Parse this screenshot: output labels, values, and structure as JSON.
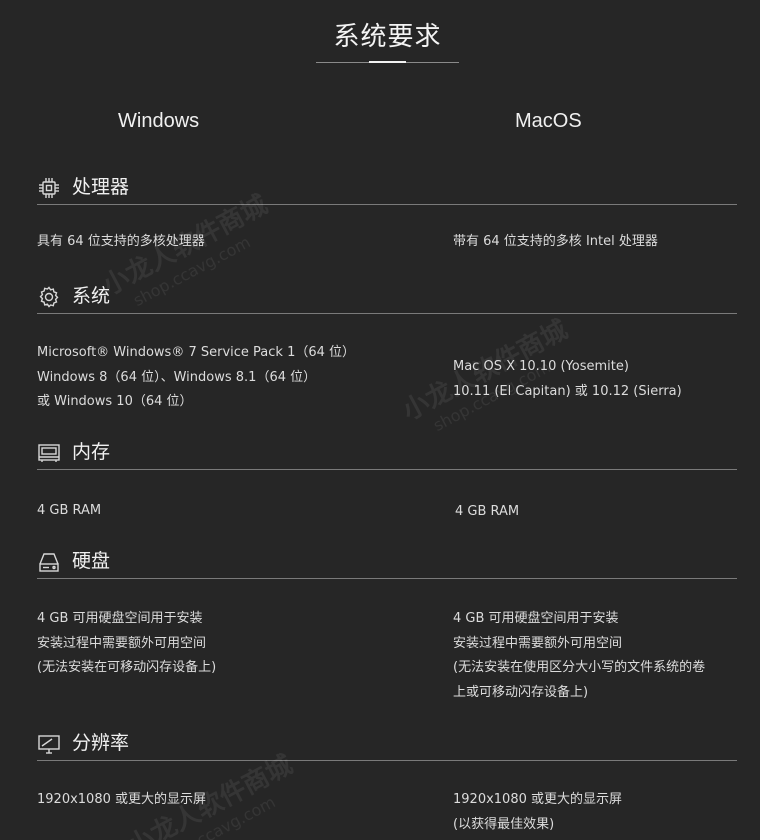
{
  "page": {
    "title": "系统要求"
  },
  "columns": {
    "windows": "Windows",
    "macos": "MacOS"
  },
  "sections": {
    "processor": {
      "label": "处理器",
      "icon": "cpu-icon",
      "windows": [
        "具有 64 位支持的多核处理器"
      ],
      "macos": [
        "带有 64 位支持的多核 Intel 处理器"
      ]
    },
    "system": {
      "label": "系统",
      "icon": "gear-icon",
      "windows": [
        "Microsoft® Windows® 7 Service Pack 1（64 位）",
        "Windows 8（64 位）、Windows 8.1（64 位）",
        "或 Windows 10（64 位）"
      ],
      "macos": [
        "Mac OS X 10.10 (Yosemite)",
        "10.11 (El Capitan) 或 10.12 (Sierra)"
      ]
    },
    "memory": {
      "label": "内存",
      "icon": "memory-icon",
      "windows": [
        "4 GB RAM"
      ],
      "macos": [
        "4 GB RAM"
      ]
    },
    "disk": {
      "label": "硬盘",
      "icon": "hard-disk-icon",
      "windows": [
        "4 GB 可用硬盘空间用于安装",
        "安装过程中需要额外可用空间",
        "(无法安装在可移动闪存设备上)"
      ],
      "macos": [
        "4 GB 可用硬盘空间用于安装",
        "安装过程中需要额外可用空间",
        "(无法安装在使用区分大小写的文件系统的卷",
        "上或可移动闪存设备上)"
      ]
    },
    "resolution": {
      "label": "分辨率",
      "icon": "monitor-icon",
      "windows": [
        "1920x1080 或更大的显示屏"
      ],
      "macos": [
        "1920x1080 或更大的显示屏",
        "(以获得最佳效果)"
      ]
    }
  },
  "watermark": {
    "text": "小龙人软件商城",
    "url": "shop.ccavg.com"
  }
}
